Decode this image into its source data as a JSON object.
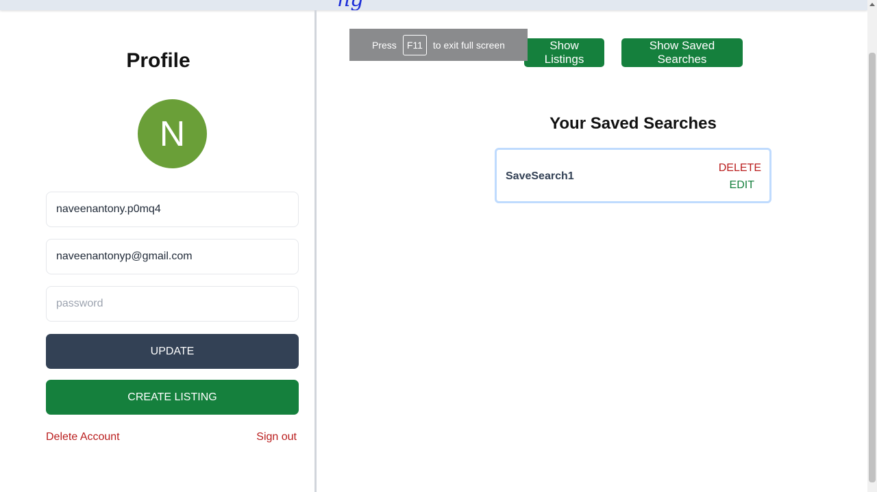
{
  "header": {
    "logo_fragment": "ng"
  },
  "profile": {
    "title": "Profile",
    "avatar_initial": "N",
    "avatar_color": "#6a9f38",
    "username_value": "naveenantony.p0mq4",
    "email_value": "naveenantonyp@gmail.com",
    "password_placeholder": "password",
    "update_label": "UPDATE",
    "create_listing_label": "CREATE LISTING",
    "delete_account_label": "Delete Account",
    "sign_out_label": "Sign out"
  },
  "fullscreen_notice": {
    "press": "Press",
    "key": "F11",
    "suffix": "to exit full screen"
  },
  "toolbar": {
    "show_listings_label": "Show Listings",
    "show_saved_searches_label": "Show Saved Searches"
  },
  "saved_searches": {
    "title": "Your Saved Searches",
    "items": [
      {
        "name": "SaveSearch1",
        "delete_label": "DELETE",
        "edit_label": "EDIT"
      }
    ]
  },
  "colors": {
    "primary_green": "#15803d",
    "update_dark": "#334155",
    "danger_red": "#b91c1c",
    "card_border": "#bfdbfe"
  }
}
